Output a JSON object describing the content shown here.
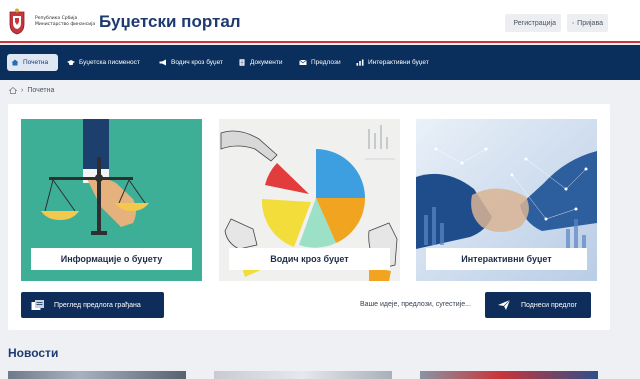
{
  "header": {
    "org_line1": "Република Србија",
    "org_line2": "Министарство финансија",
    "title": "Буџетски портал",
    "register_label": "Регистрација",
    "login_label": "Пријава"
  },
  "nav": {
    "items": [
      {
        "label": "Почетна",
        "icon": "home-icon",
        "active": true
      },
      {
        "label": "Буџетска писменост",
        "icon": "graduation-cap-icon"
      },
      {
        "label": "Водич кроз буџет",
        "icon": "megaphone-icon"
      },
      {
        "label": "Документи",
        "icon": "document-icon"
      },
      {
        "label": "Предлози",
        "icon": "envelope-icon"
      },
      {
        "label": "Интерактивни буџет",
        "icon": "chart-icon"
      }
    ]
  },
  "breadcrumb": {
    "home_icon": "home-icon",
    "separator": "›",
    "current": "Почетна"
  },
  "tiles": [
    {
      "label": "Информације о буџету",
      "image": "scales-illustration"
    },
    {
      "label": "Водич кроз буџет",
      "image": "pie-chart-hands-illustration"
    },
    {
      "label": "Интерактивни буџет",
      "image": "handshake-network-illustration"
    }
  ],
  "actions": {
    "review_label": "Преглед предлога грађана",
    "ideas_text": "Ваше идеје, предлози, сугестије...",
    "submit_label": "Поднеси предлог"
  },
  "news": {
    "title": "Новости"
  },
  "colors": {
    "navy": "#0b2f5c",
    "accent_red": "#c6363c",
    "teal": "#3eaf97"
  }
}
